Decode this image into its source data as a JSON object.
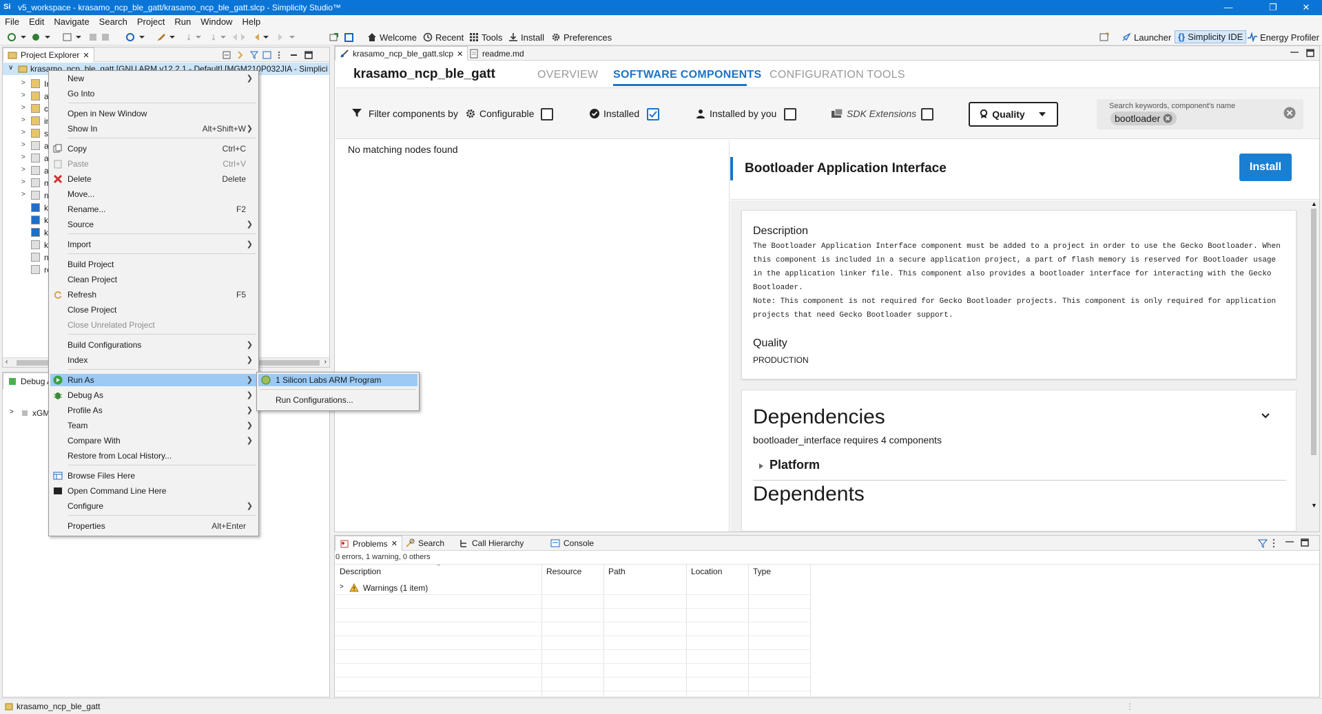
{
  "window": {
    "title": "v5_workspace - krasamo_ncp_ble_gatt/krasamo_ncp_ble_gatt.slcp - Simplicity Studio™",
    "app_icon_text": "Si"
  },
  "menubar": [
    "File",
    "Edit",
    "Navigate",
    "Search",
    "Project",
    "Run",
    "Window",
    "Help"
  ],
  "toolbar": {
    "welcome": "Welcome",
    "recent": "Recent",
    "tools": "Tools",
    "install": "Install",
    "preferences": "Preferences",
    "launcher": "Launcher",
    "simplicity_ide": "Simplicity IDE",
    "energy_profiler": "Energy Profiler"
  },
  "project_explorer": {
    "tab_label": "Project Explorer",
    "root_item": "krasamo_ncp_ble_gatt [GNU ARM v12.2.1 - Default] [MGM210P032JIA - Simplicity",
    "children": [
      "In",
      "au",
      "cc",
      "in",
      "si",
      "ap",
      "ap",
      "ap",
      "m",
      "nc",
      "kr",
      "kr",
      "kr",
      "kr",
      "nc",
      "re"
    ]
  },
  "debug_panel": {
    "tab_label": "Debug A",
    "item": "xGM"
  },
  "context_menu": {
    "items": {
      "new": "New",
      "go_into": "Go Into",
      "open_new_window": "Open in New Window",
      "show_in": "Show In",
      "show_in_acc": "Alt+Shift+W",
      "copy": "Copy",
      "copy_acc": "Ctrl+C",
      "paste": "Paste",
      "paste_acc": "Ctrl+V",
      "delete": "Delete",
      "delete_acc": "Delete",
      "move": "Move...",
      "rename": "Rename...",
      "rename_acc": "F2",
      "source": "Source",
      "import": "Import",
      "build_project": "Build Project",
      "clean_project": "Clean Project",
      "refresh": "Refresh",
      "refresh_acc": "F5",
      "close_project": "Close Project",
      "close_unrelated": "Close Unrelated Project",
      "build_configs": "Build Configurations",
      "index": "Index",
      "run_as": "Run As",
      "debug_as": "Debug As",
      "profile_as": "Profile As",
      "team": "Team",
      "compare_with": "Compare With",
      "restore_history": "Restore from Local History...",
      "browse_files": "Browse Files Here",
      "open_cmd": "Open Command Line Here",
      "configure": "Configure",
      "properties": "Properties",
      "properties_acc": "Alt+Enter"
    }
  },
  "submenu": {
    "run_arm": "1 Silicon Labs ARM Program",
    "run_configs": "Run Configurations..."
  },
  "editor": {
    "tabs": [
      "krasamo_ncp_ble_gatt.slcp",
      "readme.md"
    ],
    "project_title": "krasamo_ncp_ble_gatt",
    "nav": [
      "OVERVIEW",
      "SOFTWARE COMPONENTS",
      "CONFIGURATION TOOLS"
    ],
    "filter": {
      "label": "Filter components by",
      "configurable": "Configurable",
      "configurable_checked": false,
      "installed": "Installed",
      "installed_checked": true,
      "installed_by_you": "Installed by you",
      "installed_by_you_checked": false,
      "sdk_extensions": "SDK Extensions",
      "sdk_extensions_checked": false,
      "quality": "Quality"
    },
    "search": {
      "label": "Search keywords, component's name",
      "chip": "bootloader"
    },
    "tree_empty": "No matching nodes found",
    "component": {
      "title": "Bootloader Application Interface",
      "install_button": "Install",
      "description_heading": "Description",
      "description_lines": [
        "The Bootloader Application Interface component must be added to a project in order to use the Gecko Bootloader. When",
        "this component is included in a secure application project, a part of flash memory is reserved for Bootloader usage",
        "in the application linker file. This component also provides a bootloader interface for interacting with the Gecko",
        "Bootloader.",
        "Note: This component is not required for Gecko Bootloader projects. This component is only required for application",
        "projects that need Gecko Bootloader support."
      ],
      "quality_heading": "Quality",
      "quality_value": "PRODUCTION",
      "dependencies_heading": "Dependencies",
      "dependencies_summary": "bootloader_interface requires 4 components",
      "platform": "Platform",
      "dependents_heading": "Dependents"
    }
  },
  "problems": {
    "tabs": [
      "Problems",
      "Search",
      "Call Hierarchy",
      "Console"
    ],
    "summary": "0 errors, 1 warning, 0 others",
    "columns": [
      "Description",
      "Resource",
      "Path",
      "Location",
      "Type"
    ],
    "rows": [
      "Warnings (1 item)"
    ]
  },
  "statusbar": {
    "selected": "krasamo_ncp_ble_gatt"
  },
  "colors": {
    "accent": "#0a75d6",
    "install_button": "#1a7fd1",
    "nav_active": "#1a73c8",
    "menu_highlight": "#9ccaf5"
  }
}
